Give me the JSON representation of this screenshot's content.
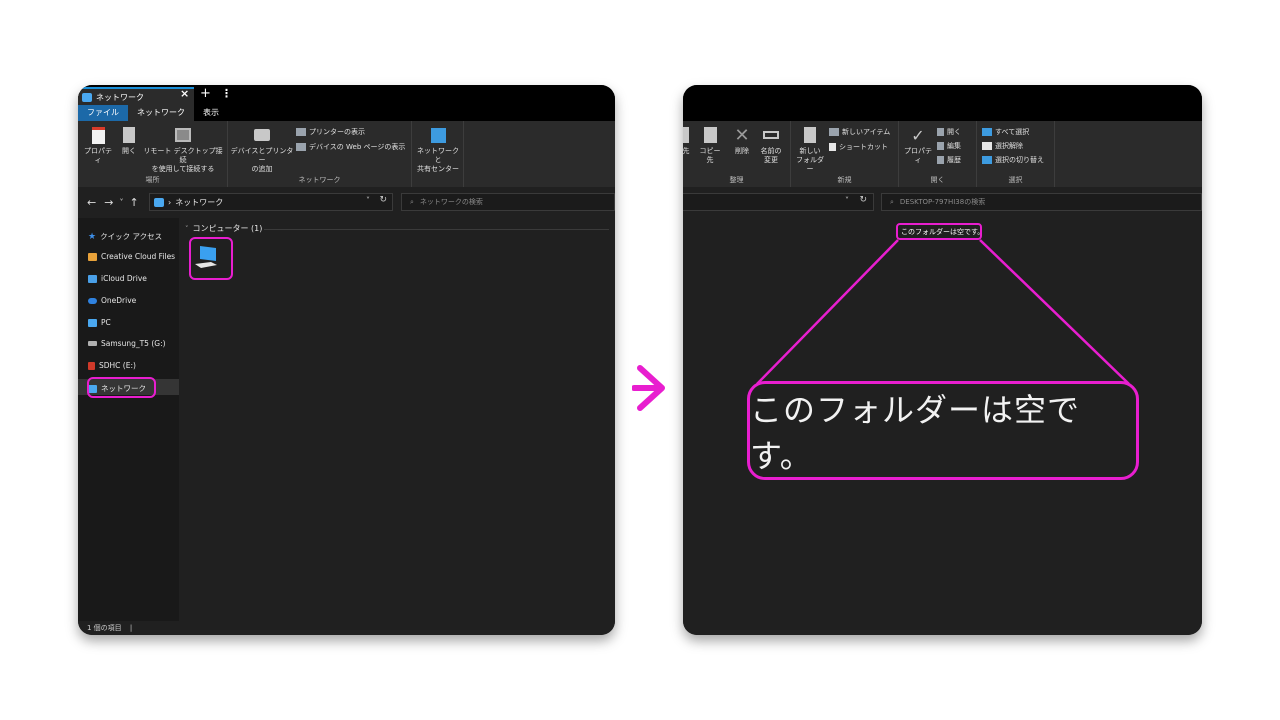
{
  "left_window": {
    "tab_title": "ネットワーク",
    "tab_close": "×",
    "tab_plus": "+",
    "tab_more": "⋮",
    "ribbon_tabs": [
      "ファイル",
      "ネットワーク",
      "表示"
    ],
    "ribbon": {
      "properties": "プロパティ",
      "open": "開く",
      "remote_desktop": "リモート デスクトップ接続\nを使用して接続する",
      "add_devices": "デバイスとプリンター\nの追加",
      "show_printers": "プリンターの表示",
      "show_device_web": "デバイスの Web ページの表示",
      "network_center": "ネットワークと\n共有センター",
      "group_location": "場所",
      "group_network": "ネットワーク"
    },
    "nav": {
      "back": "←",
      "forward": "→",
      "recent": "˅",
      "up": "↑",
      "chevron": "›"
    },
    "address": "ネットワーク",
    "address_dropdown": "˅",
    "refresh": "↻",
    "search_placeholder": "ネットワークの検索",
    "search_icon": "⌕",
    "sidebar": [
      {
        "label": "クイック アクセス",
        "icon": "star-icon",
        "color": "#3d8ee8"
      },
      {
        "label": "Creative Cloud Files",
        "icon": "creative-cloud-icon",
        "color": "#e8a23a"
      },
      {
        "label": "iCloud Drive",
        "icon": "icloud-icon",
        "color": "#4aa0e8"
      },
      {
        "label": "OneDrive",
        "icon": "onedrive-icon",
        "color": "#2f82e0"
      },
      {
        "label": "PC",
        "icon": "pc-icon",
        "color": "#4aa8f0"
      },
      {
        "label": "Samsung_T5 (G:)",
        "icon": "drive-icon",
        "color": "#b0b0b0"
      },
      {
        "label": "SDHC (E:)",
        "icon": "sdcard-icon",
        "color": "#d03a2a"
      },
      {
        "label": "ネットワーク",
        "icon": "network-icon",
        "color": "#4aa8f0"
      }
    ],
    "group_header": "コンピューター (1)",
    "status": "1 個の項目",
    "status_sep": "|"
  },
  "right_window": {
    "ribbon": {
      "copy_path_partial": "先",
      "copy_to": "コピー先",
      "delete": "削除",
      "rename": "名前の\n変更",
      "new_folder": "新しい\nフォルダー",
      "new_item": "新しいアイテム",
      "shortcut": "ショートカット",
      "properties": "プロパティ",
      "open": "開く",
      "edit": "編集",
      "history": "履歴",
      "select_all": "すべて選択",
      "select_none": "選択解除",
      "invert_selection": "選択の切り替え",
      "group_organize": "整理",
      "group_new": "新規",
      "group_open": "開く",
      "group_select": "選択"
    },
    "address_dropdown": "˅",
    "refresh": "↻",
    "search_placeholder": "DESKTOP-797HI38の検索",
    "search_icon": "⌕",
    "empty_message": "このフォルダーは空です。"
  },
  "zoom_text": "このフォルダーは空です。",
  "colors": {
    "highlight": "#e81ecf",
    "accent": "#1c69a8",
    "window_bg": "#202020",
    "ribbon_bg": "#2b2b2b"
  }
}
